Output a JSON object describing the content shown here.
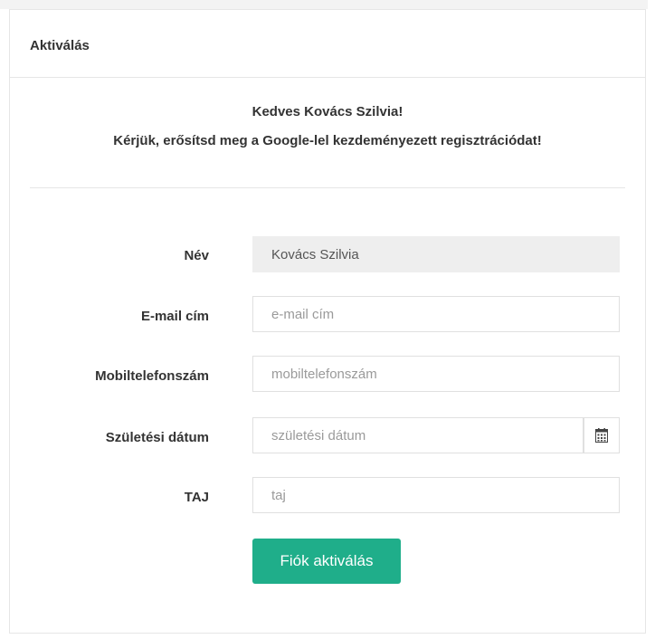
{
  "panel": {
    "title": "Aktiválás"
  },
  "message": {
    "greeting": "Kedves Kovács Szilvia!",
    "instruction": "Kérjük, erősítsd meg a Google-lel kezdeményezett regisztrációdat!"
  },
  "form": {
    "name": {
      "label": "Név",
      "value": "Kovács Szilvia"
    },
    "email": {
      "label": "E-mail cím",
      "placeholder": "e-mail cím"
    },
    "mobile": {
      "label": "Mobiltelefonszám",
      "placeholder": "mobiltelefonszám"
    },
    "birthdate": {
      "label": "Születési dátum",
      "placeholder": "születési dátum",
      "icon": "calendar-icon"
    },
    "taj": {
      "label": "TAJ",
      "placeholder": "taj"
    },
    "submit_label": "Fiók aktiválás"
  },
  "colors": {
    "accent": "#1fae8a",
    "border": "#e6e6e6",
    "disabled_bg": "#eeeeee",
    "text": "#333333"
  }
}
